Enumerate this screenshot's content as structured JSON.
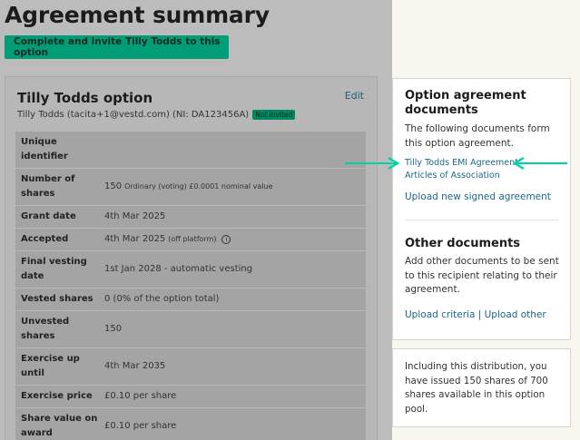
{
  "page_title": "Agreement summary",
  "cta_label": "Complete and invite Tilly Todds to this option",
  "option": {
    "title": "Tilly Todds option",
    "edit_label": "Edit",
    "subline": "Tilly Todds (tacita+1@vestd.com) (NI: DA123456A)",
    "badge": "Not invited",
    "rows": [
      {
        "key": "Unique identifier",
        "value": ""
      },
      {
        "key": "Number of shares",
        "value": "150",
        "note": "Ordinary (voting) £0.0001 nominal value"
      },
      {
        "key": "Grant date",
        "value": "4th Mar 2025"
      },
      {
        "key": "Accepted",
        "value": "4th Mar 2025",
        "note": "(off platform)"
      },
      {
        "key": "Final vesting date",
        "value": "1st Jan 2028 - automatic vesting"
      },
      {
        "key": "Vested shares",
        "value": "0 (0% of the option total)"
      },
      {
        "key": "Unvested shares",
        "value": "150"
      },
      {
        "key": "Exercise up until",
        "value": "4th Mar 2035"
      },
      {
        "key": "Exercise price",
        "value": "£0.10 per share"
      },
      {
        "key": "Share value on award",
        "value": "£0.10 per share"
      }
    ]
  },
  "agreement_docs": {
    "title": "Option agreement documents",
    "description": "The following documents form this option agreement.",
    "doc_emi": "Tilly Todds EMI Agreement",
    "doc_articles": "Articles of Association",
    "upload_signed": "Upload new signed agreement"
  },
  "other_docs": {
    "title": "Other documents",
    "description": "Add other documents to be sent to this recipient relating to their agreement.",
    "upload_criteria": "Upload criteria",
    "separator": "|",
    "upload_other": "Upload other"
  },
  "pool_info": "Including this distribution, you have issued 150 shares of 700 shares available in this option pool.",
  "colors": {
    "accent": "#00c9a0",
    "link": "#1e6784",
    "cta": "#009d76"
  }
}
